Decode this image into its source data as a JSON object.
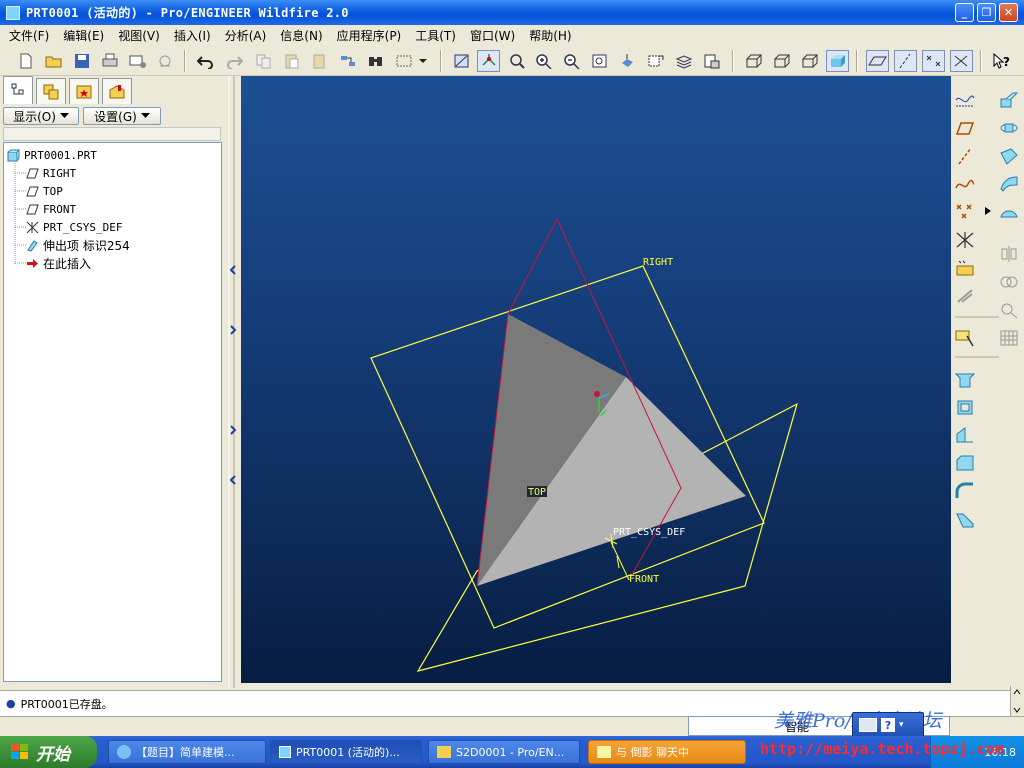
{
  "window": {
    "title": "PRT0001 (活动的) - Pro/ENGINEER Wildfire 2.0",
    "buttons": {
      "minimize": "_",
      "maximize": "❐",
      "close": "✕"
    }
  },
  "menu": [
    "文件(F)",
    "编辑(E)",
    "视图(V)",
    "插入(I)",
    "分析(A)",
    "信息(N)",
    "应用程序(P)",
    "工具(T)",
    "窗口(W)",
    "帮助(H)"
  ],
  "toolbar": {
    "icons": [
      "new-icon",
      "open-icon",
      "save-icon",
      "print-icon",
      "send-icon",
      "mail-icon",
      "regenerate-undo-icon",
      "redo-icon",
      "copy-icon",
      "paste-icon",
      "paste-special-icon",
      "regenerate-icon",
      "find-icon",
      "select-box-icon",
      "dropdown-icon",
      "orient-icon",
      "spin-center-icon",
      "zoom-fit-icon",
      "zoom-in-icon",
      "zoom-out-icon",
      "refit-icon",
      "reorient-icon",
      "view-manager-icon",
      "layers-icon",
      "saved-views-icon",
      "wireframe-icon",
      "hidden-line-icon",
      "no-hidden-icon",
      "shaded-icon",
      "datum-planes-icon",
      "datum-axes-icon",
      "datum-points-icon",
      "csys-icon",
      "whats-this-icon"
    ]
  },
  "left_panel": {
    "tabs": [
      "model-tree-tab",
      "layer-tab",
      "favorites-tab",
      "folder-tab"
    ],
    "show_button": "显示(O)",
    "settings_button": "设置(G)",
    "tree": [
      {
        "label": "PRT0001.PRT",
        "icon": "part-icon",
        "level": 0
      },
      {
        "label": "RIGHT",
        "icon": "datum-plane-icon",
        "level": 1
      },
      {
        "label": "TOP",
        "icon": "datum-plane-icon",
        "level": 1
      },
      {
        "label": "FRONT",
        "icon": "datum-plane-icon",
        "level": 1
      },
      {
        "label": "PRT_CSYS_DEF",
        "icon": "csys-icon",
        "level": 1
      },
      {
        "label": "伸出项 标识254",
        "icon": "protrusion-icon",
        "level": 1
      },
      {
        "label": "在此插入",
        "icon": "insert-here-arrow-icon",
        "level": 1
      }
    ]
  },
  "viewport": {
    "labels": {
      "right": "RIGHT",
      "top": "TOP",
      "csys": "PRT_CSYS_DEF",
      "front": "FRONT"
    },
    "colors": {
      "datum": "#ffff3c",
      "sketch": "#c8143c",
      "face_dark": "#7b7b7b",
      "face_light": "#b4b4b4"
    }
  },
  "right_toolbar": {
    "icons": [
      "sketched-datum-curve-icon",
      "datum-plane-tool-icon",
      "datum-axis-tool-icon",
      "datum-curve-tool-icon",
      "datum-point-tool-icon",
      "csys-tool-icon",
      "analysis-feature-icon",
      "sketch-tool-icon",
      "extrude-icon",
      "revolve-icon",
      "sweep-icon",
      "blend-icon",
      "hole-icon",
      "shell-icon",
      "rib-icon",
      "draft-icon",
      "round-icon",
      "chamfer-icon",
      "mirror-icon",
      "merge-icon",
      "trim-icon",
      "pattern-icon"
    ]
  },
  "status": {
    "message": "PRT0001已存盘。",
    "filter": "智能"
  },
  "taskbar": {
    "start": "开始",
    "tasks": [
      "【题目】简单建模...",
      "PRT0001 (活动的)...",
      "S2D0001 - Pro/EN...",
      "与 倒影 聊天中"
    ],
    "time": "16:18"
  },
  "watermark": {
    "forum": "美雅Pro/E中文论坛",
    "url": "http://meiya.tech.topzj.com"
  }
}
